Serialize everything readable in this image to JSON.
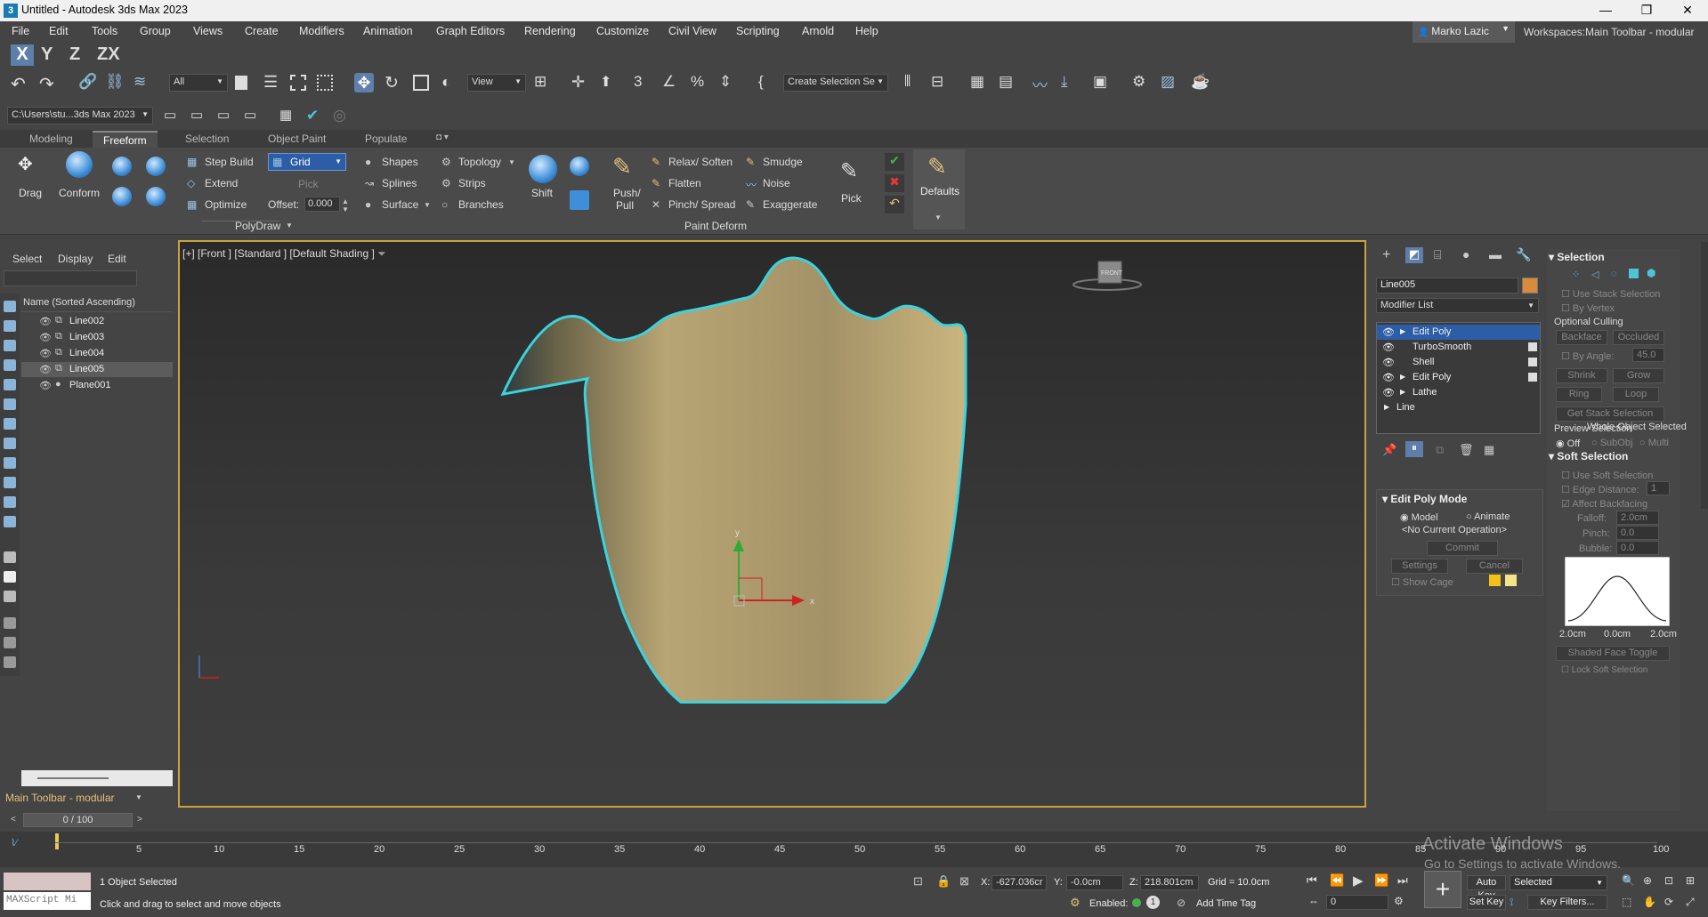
{
  "window": {
    "title": "Untitled - Autodesk 3ds Max 2023",
    "minimize": "—",
    "maximize": "❐",
    "close": "✕"
  },
  "menu": {
    "items": [
      "File",
      "Edit",
      "Tools",
      "Group",
      "Views",
      "Create",
      "Modifiers",
      "Animation",
      "Graph Editors",
      "Rendering",
      "Customize",
      "Civil View",
      "Scripting",
      "Arnold",
      "Help"
    ],
    "user": "Marko Lazic",
    "workspaces_label": "Workspaces:",
    "workspace_value": "Main Toolbar - modular"
  },
  "axis_constraints": [
    "X",
    "Y",
    "Z",
    "ZX"
  ],
  "toolbar": {
    "selection_filter": "All",
    "ref_coord": "View",
    "create_selection_set": "Create Selection Se"
  },
  "project": {
    "path": "C:\\Users\\stu...3ds Max 2023"
  },
  "ribbon": {
    "tabs": [
      "Modeling",
      "Freeform",
      "Selection",
      "Object Paint",
      "Populate"
    ],
    "active_tab": "Freeform",
    "drag": "Drag",
    "conform": "Conform",
    "step_build": "Step Build",
    "extend": "Extend",
    "optimize": "Optimize",
    "grid": "Grid",
    "pick_dim": "Pick",
    "offset_label": "Offset:",
    "offset_value": "0.000",
    "shapes": "Shapes",
    "splines": "Splines",
    "surface": "Surface",
    "topology": "Topology",
    "strips": "Strips",
    "branches": "Branches",
    "shift": "Shift",
    "push_pull_1": "Push/",
    "push_pull_2": "Pull",
    "relax_soften": "Relax/ Soften",
    "flatten": "Flatten",
    "pinch_spread": "Pinch/ Spread",
    "smudge": "Smudge",
    "noise": "Noise",
    "exaggerate": "Exaggerate",
    "pick": "Pick",
    "defaults": "Defaults",
    "group_polydraw": "PolyDraw",
    "group_paint_deform": "Paint Deform"
  },
  "scene_explorer": {
    "tabs": [
      "Select",
      "Display",
      "Edit"
    ],
    "column_header": "Name (Sorted Ascending)",
    "objects": [
      {
        "name": "Line002",
        "selected": false
      },
      {
        "name": "Line003",
        "selected": false
      },
      {
        "name": "Line004",
        "selected": false
      },
      {
        "name": "Line005",
        "selected": true
      },
      {
        "name": "Plane001",
        "selected": false
      }
    ],
    "workspace_dropdown": "Main Toolbar - modular",
    "frame_counter": "0 / 100"
  },
  "viewport": {
    "label": "[+] [Front ] [Standard ] [Default Shading ]",
    "viewcube_label": "FRONT",
    "gizmo_x": "x",
    "gizmo_y": "y"
  },
  "command_panel": {
    "object_name": "Line005",
    "object_color": "#d98a3a",
    "modifier_list": "Modifier List",
    "stack": [
      "Edit Poly",
      "TurboSmooth",
      "Shell",
      "Edit Poly",
      "Lathe",
      "Line"
    ],
    "selection_header": "Selection",
    "use_stack_selection": "Use Stack Selection",
    "by_vertex": "By Vertex",
    "optional_culling": "Optional Culling",
    "backface": "Backface",
    "occluded": "Occluded",
    "by_angle": "By Angle:",
    "by_angle_value": "45.0",
    "shrink": "Shrink",
    "grow": "Grow",
    "ring": "Ring",
    "loop": "Loop",
    "get_stack_selection": "Get Stack Selection",
    "preview_selection": "Preview Selection",
    "preview_off": "Off",
    "preview_subobj": "SubObj",
    "preview_multi": "Multi",
    "whole_object_selected": "Whole Object Selected",
    "soft_selection_header": "Soft Selection",
    "use_soft_selection": "Use Soft Selection",
    "edge_distance": "Edge Distance:",
    "edge_distance_value": "1",
    "affect_backfacing": "Affect Backfacing",
    "falloff": "Falloff:",
    "falloff_value": "2.0cm",
    "pinch": "Pinch:",
    "pinch_value": "0.0",
    "bubble": "Bubble:",
    "bubble_value": "0.0",
    "curve_left": "2.0cm",
    "curve_mid": "0.0cm",
    "curve_right": "2.0cm",
    "shaded_face_toggle": "Shaded Face Toggle",
    "lock_soft_selection": "Lock Soft Selection",
    "edit_poly_mode_header": "Edit Poly Mode",
    "model": "Model",
    "animate": "Animate",
    "no_current_operation": "<No Current Operation>",
    "commit": "Commit",
    "settings": "Settings",
    "cancel": "Cancel",
    "show_cage": "Show Cage"
  },
  "timeline": {
    "ticks": [
      "5",
      "10",
      "15",
      "20",
      "25",
      "30",
      "35",
      "40",
      "45",
      "50",
      "55",
      "60",
      "65",
      "70",
      "75",
      "80",
      "85",
      "90",
      "95",
      "100"
    ]
  },
  "status": {
    "maxscript": "MAXScript Mi",
    "objects_selected": "1 Object Selected",
    "prompt": "Click and drag to select and move objects",
    "x_label": "X:",
    "x_value": "-627.036cr",
    "y_label": "Y:",
    "y_value": "-0.0cm",
    "z_label": "Z:",
    "z_value": "218.801cm",
    "grid": "Grid = 10.0cm",
    "enabled_label": "Enabled:",
    "add_time_tag": "Add Time Tag",
    "auto_key": "Auto Key",
    "selected": "Selected",
    "set_key": "Set Key",
    "key_filters": "Key Filters...",
    "frame_value": "0",
    "activate_1": "Activate Windows",
    "activate_2": "Go to Settings to activate Windows."
  }
}
